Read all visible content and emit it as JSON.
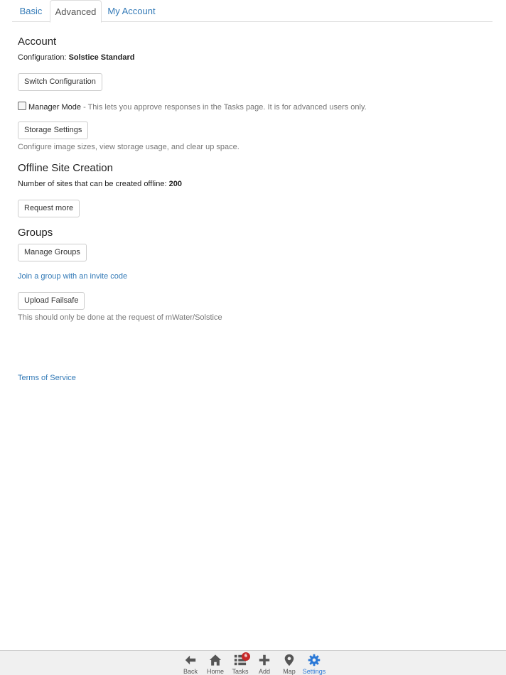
{
  "tabs": [
    {
      "label": "Basic"
    },
    {
      "label": "Advanced"
    },
    {
      "label": "My Account"
    }
  ],
  "account": {
    "heading": "Account",
    "config_label": "Configuration:",
    "config_value": "Solstice Standard",
    "switch_button": "Switch Configuration",
    "manager_mode_label": "Manager Mode",
    "manager_mode_checked": false,
    "manager_mode_desc": "- This lets you approve responses in the Tasks page. It is for advanced users only.",
    "storage_button": "Storage Settings",
    "storage_desc": "Configure image sizes, view storage usage, and clear up space."
  },
  "offline": {
    "heading": "Offline Site Creation",
    "sites_label": "Number of sites that can be created offline:",
    "sites_value": "200",
    "request_button": "Request more"
  },
  "groups": {
    "heading": "Groups",
    "manage_button": "Manage Groups",
    "join_link": "Join a group with an invite code"
  },
  "failsafe": {
    "upload_button": "Upload Failsafe",
    "desc": "This should only be done at the request of mWater/Solstice"
  },
  "terms_link": "Terms of Service",
  "bottom_nav": {
    "back": "Back",
    "home": "Home",
    "tasks": "Tasks",
    "tasks_badge": "6",
    "add": "Add",
    "map": "Map",
    "settings": "Settings",
    "active_color": "#2a78d6",
    "icon_color": "#555555",
    "badge_color": "#c62828"
  }
}
